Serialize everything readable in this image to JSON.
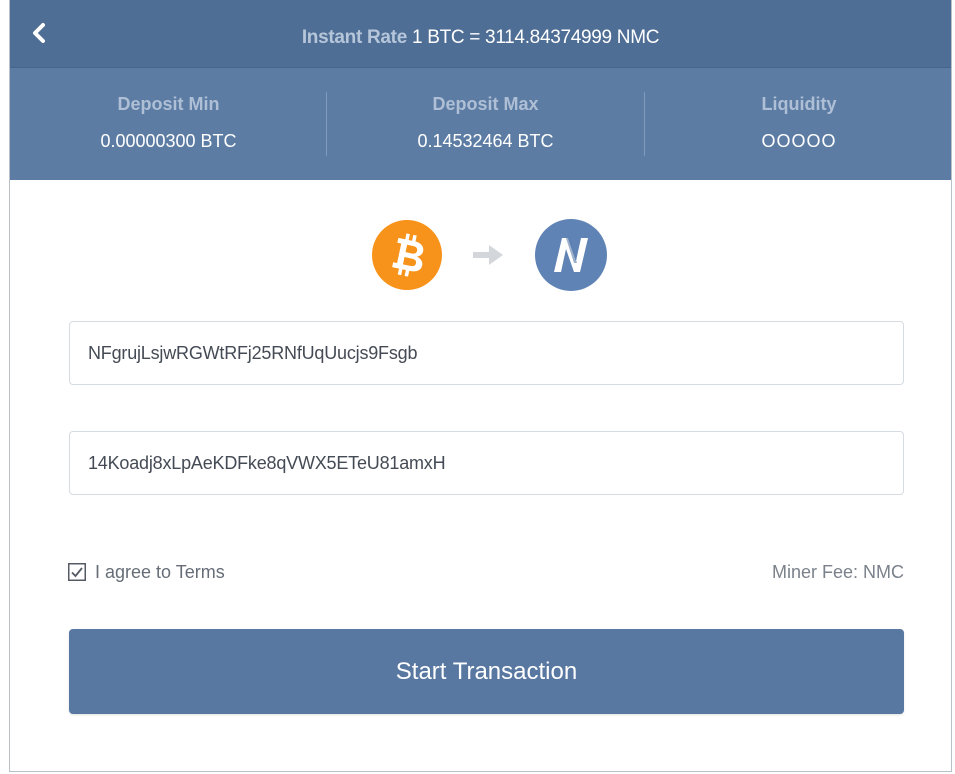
{
  "colors": {
    "header_bg": "#4f6e95",
    "stats_bg": "#5c7ca3",
    "primary_button": "#5878a1",
    "btc_orange": "#f7931a",
    "nmc_blue": "#5f83b5",
    "arrow_gray": "#d3d6da"
  },
  "header": {
    "back_icon": "chevron-left-icon",
    "rate_label": "Instant Rate",
    "rate_value": " 1 BTC = 3114.84374999 NMC"
  },
  "stats": [
    {
      "label": "Deposit Min",
      "value": "0.00000300 BTC"
    },
    {
      "label": "Deposit Max",
      "value": "0.14532464 BTC"
    },
    {
      "label": "Liquidity",
      "value": "OOOOO"
    }
  ],
  "pair": {
    "from_icon": "bitcoin-icon",
    "arrow_icon": "arrow-right-icon",
    "to_icon": "namecoin-icon"
  },
  "form": {
    "destination_address": "NFgrujLsjwRGWtRFj25RNfUqUucjs9Fsgb",
    "refund_address": "14Koadj8xLpAeKDFke8qVWX5ETeU81amxH",
    "agree_checked": true,
    "agree_label": "I agree to Terms",
    "miner_fee": "Miner Fee: NMC",
    "submit_label": "Start Transaction"
  }
}
